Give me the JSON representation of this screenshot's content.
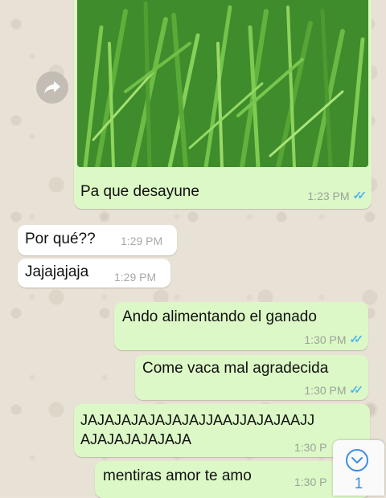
{
  "colors": {
    "outgoing_bubble": "#dcf8c6",
    "incoming_bubble": "#ffffff",
    "read_ticks": "#4fb6ec",
    "unread_badge": "#3c8fe0"
  },
  "messages": [
    {
      "direction": "outgoing",
      "type": "image",
      "caption": "Pa que desayune",
      "time": "1:23 PM",
      "status": "read"
    },
    {
      "direction": "incoming",
      "type": "text",
      "text": "Por qué??",
      "time": "1:29 PM"
    },
    {
      "direction": "incoming",
      "type": "text",
      "text": "Jajajajaja",
      "time": "1:29 PM"
    },
    {
      "direction": "outgoing",
      "type": "text",
      "text": "Ando alimentando el ganado",
      "time": "1:30 PM",
      "status": "read"
    },
    {
      "direction": "outgoing",
      "type": "text",
      "text": "Come vaca mal agradecida",
      "time": "1:30 PM",
      "status": "read"
    },
    {
      "direction": "outgoing",
      "type": "text",
      "text": "JAJAJAJAJAJAJAJJAAJJAJAJAAJJ\nAJAJAJAJAJAJA",
      "time": "1:30 P"
    },
    {
      "direction": "outgoing",
      "type": "text",
      "text": "mentiras amor te amo",
      "time": "1:30 P"
    }
  ],
  "icons": {
    "forward": "forward-arrow-icon",
    "scroll_down": "chevron-down-circle-icon",
    "read_status": "double-check-icon"
  },
  "scroll_button": {
    "unread_count": "1"
  }
}
